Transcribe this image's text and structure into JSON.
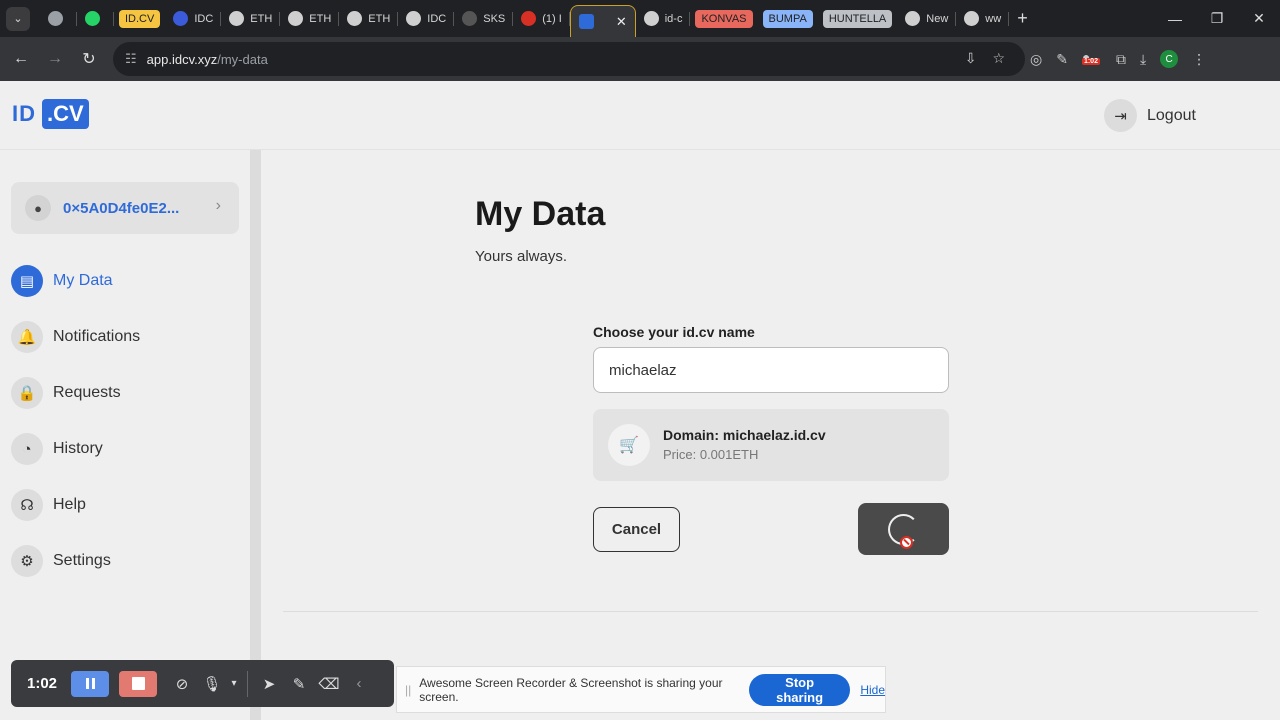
{
  "browser": {
    "tabs": [
      {
        "label": "",
        "chip": "",
        "fav": "#9aa0a6",
        "fav_icon": "openai-icon"
      },
      {
        "label": "",
        "chip": "",
        "fav": "#25d366",
        "fav_icon": "whatsapp-icon"
      },
      {
        "label": "ID.CV",
        "chip": "#f5c542",
        "chip_text": "#202124"
      },
      {
        "label": "IDC",
        "fav": "#3b5bdb",
        "fav_icon": "idc-icon"
      },
      {
        "label": "ETH",
        "fav": "#cfcfcf",
        "fav_icon": "eth-icon"
      },
      {
        "label": "ETH",
        "fav": "#cfcfcf",
        "fav_icon": "eth-icon"
      },
      {
        "label": "ETH",
        "fav": "#cfcfcf",
        "fav_icon": "eth-icon"
      },
      {
        "label": "IDC",
        "fav": "#cfcfcf",
        "fav_icon": "idc-icon"
      },
      {
        "label": "SKS",
        "fav": "#555",
        "fav_icon": "github-icon"
      },
      {
        "label": "(1) I",
        "fav": "#d93025",
        "fav_icon": "notify-icon"
      }
    ],
    "active_tab": {
      "label": "",
      "close": "✕"
    },
    "tabs_after": [
      {
        "label": "id-c",
        "fav_icon": "triangle-icon"
      },
      {
        "label": "KONVAS",
        "chip": "#e8685d",
        "chip_text": "#202124"
      },
      {
        "label": "BUMPA",
        "chip": "#8ab4f8",
        "chip_text": "#202124"
      },
      {
        "label": "HUNTELLA",
        "chip": "#bdc1c6",
        "chip_text": "#202124"
      },
      {
        "label": "New",
        "fav_icon": "chrome-icon"
      },
      {
        "label": "ww",
        "fav_icon": "globe-icon"
      }
    ],
    "new_tab": "+",
    "url_host": "app.idcv.xyz",
    "url_path": "/my-data",
    "recording_time_badge": "1:02",
    "profile_initial": "C"
  },
  "app": {
    "logo_id": "ID",
    "logo_cv": ".CV",
    "logout_label": "Logout",
    "wallet_address": "0×5A0D4fe0E2...",
    "nav": [
      {
        "label": "My Data",
        "icon": "document-icon",
        "glyph": "▤",
        "active": true
      },
      {
        "label": "Notifications",
        "icon": "bell-icon",
        "glyph": "🔔"
      },
      {
        "label": "Requests",
        "icon": "lock-icon",
        "glyph": "🔒"
      },
      {
        "label": "History",
        "icon": "history-icon",
        "glyph": "◔"
      },
      {
        "label": "Help",
        "icon": "help-icon",
        "glyph": "☊"
      },
      {
        "label": "Settings",
        "icon": "gear-icon",
        "glyph": "⚙"
      }
    ],
    "page_title": "My Data",
    "page_subtitle": "Yours always.",
    "name_field_label": "Choose your id.cv name",
    "name_value": "michaelaz",
    "domain_text": "Domain: michaelaz.id.cv",
    "price_text": "Price: 0.001ETH",
    "cancel_label": "Cancel"
  },
  "recorder": {
    "time": "1:02",
    "share_message": "Awesome Screen Recorder & Screenshot is sharing your screen.",
    "stop_sharing_label": "Stop sharing",
    "hide_label": "Hide"
  }
}
